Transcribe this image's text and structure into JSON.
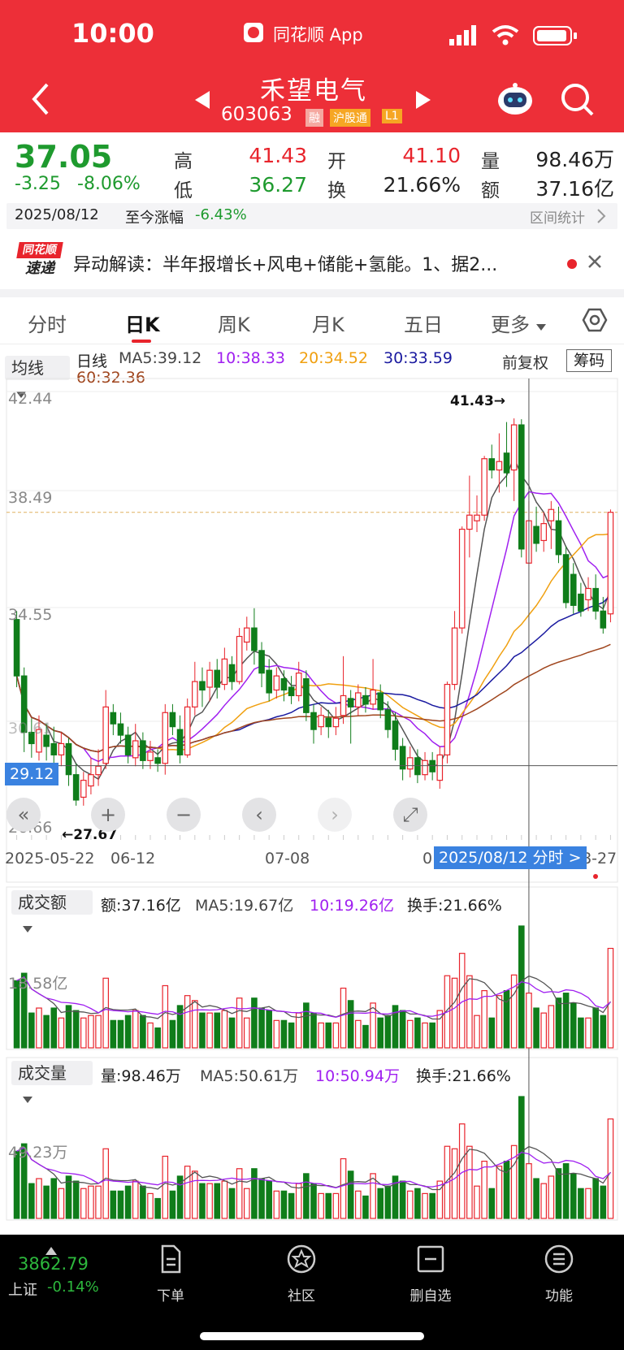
{
  "status_bar": {
    "time": "10:00",
    "app_name": "同花顺 App"
  },
  "header": {
    "stock_name": "禾望电气",
    "stock_code": "603063",
    "tags": [
      "融",
      "沪股通",
      "L1"
    ]
  },
  "quote": {
    "price": "37.05",
    "change": "-3.25",
    "change_pct": "-8.06%",
    "high_label": "高",
    "high": "41.43",
    "low_label": "低",
    "low": "36.27",
    "open_label": "开",
    "open": "41.10",
    "turnover_label": "换",
    "turnover": "21.66%",
    "volume_label": "量",
    "volume": "98.46万",
    "amount_label": "额",
    "amount": "37.16亿"
  },
  "date_bar": {
    "date": "2025/08/12",
    "since_label": "至今涨幅",
    "since_value": "-6.43%",
    "range_stats": "区间统计"
  },
  "news": {
    "logo_top": "同花顺",
    "logo_bottom": "速递",
    "text": "异动解读：半年报增长+风电+储能+氢能。1、据2..."
  },
  "tabs": [
    "分时",
    "日K",
    "周K",
    "月K",
    "五日",
    "更多"
  ],
  "ma_bar": {
    "dropdown": "均线",
    "period": "日线",
    "ma5": "MA5:39.12",
    "ma10": "10:38.33",
    "ma20": "20:34.52",
    "ma30": "30:33.59",
    "ma60": "60:32.36",
    "adjust": "前复权",
    "chips": "筹码"
  },
  "kline": {
    "y_labels": [
      "42.44",
      "38.49",
      "34.55",
      "30.61",
      "26.66"
    ],
    "current_price_tag": "29.12",
    "high_marker": "41.43→",
    "low_marker": "←27.67",
    "x_labels": [
      "2025-05-22",
      "06-12",
      "07-08",
      "0",
      "8-27"
    ],
    "crosshair_label": "2025/08/12 分时 >"
  },
  "amount_panel": {
    "dropdown": "成交额",
    "value": "额:37.16亿",
    "ma5": "MA5:19.67亿",
    "ma10": "10:19.26亿",
    "turnover": "换手:21.66%",
    "y_label": "18.58亿"
  },
  "volume_panel": {
    "dropdown": "成交量",
    "value": "量:98.46万",
    "ma5": "MA5:50.61万",
    "ma10": "10:50.94万",
    "turnover": "换手:21.66%",
    "y_label": "49.23万"
  },
  "bottom_nav": {
    "index_value": "3862.79",
    "index_name": "上证",
    "index_change": "-0.14%",
    "items": [
      "下单",
      "社区",
      "删自选",
      "功能"
    ]
  },
  "colors": {
    "up": "#e8242c",
    "down": "#0f7d1a",
    "ma5": "#555555",
    "ma10": "#a020f0",
    "ma20": "#f0a010",
    "ma30": "#1a1aa0",
    "ma60": "#a0461e",
    "header": "#ed2f38"
  },
  "chart_data": {
    "type": "candlestick",
    "ylim": [
      26.66,
      42.44
    ],
    "candles": [
      {
        "o": 34.3,
        "c": 32.3,
        "h": 34.6,
        "l": 31.9
      },
      {
        "o": 32.3,
        "c": 30.3,
        "h": 32.6,
        "l": 29.6
      },
      {
        "o": 30.3,
        "c": 29.9,
        "h": 30.8,
        "l": 29.4
      },
      {
        "o": 29.6,
        "c": 30.4,
        "h": 30.9,
        "l": 29.3
      },
      {
        "o": 30.2,
        "c": 29.8,
        "h": 30.6,
        "l": 29.3
      },
      {
        "o": 29.9,
        "c": 29.5,
        "h": 30.5,
        "l": 28.9
      },
      {
        "o": 29.5,
        "c": 29.9,
        "h": 30.3,
        "l": 29.1
      },
      {
        "o": 29.9,
        "c": 28.8,
        "h": 30.1,
        "l": 28.4
      },
      {
        "o": 28.8,
        "c": 27.9,
        "h": 29.2,
        "l": 27.7
      },
      {
        "o": 28.0,
        "c": 28.6,
        "h": 28.9,
        "l": 27.7
      },
      {
        "o": 28.4,
        "c": 28.8,
        "h": 29.4,
        "l": 28.1
      },
      {
        "o": 28.8,
        "c": 29.1,
        "h": 29.7,
        "l": 28.4
      },
      {
        "o": 29.2,
        "c": 31.2,
        "h": 31.8,
        "l": 29.0
      },
      {
        "o": 31.0,
        "c": 30.6,
        "h": 31.3,
        "l": 30.2
      },
      {
        "o": 30.6,
        "c": 30.2,
        "h": 31.0,
        "l": 29.9
      },
      {
        "o": 30.2,
        "c": 29.5,
        "h": 30.5,
        "l": 29.2
      },
      {
        "o": 29.4,
        "c": 30.0,
        "h": 30.6,
        "l": 29.1
      },
      {
        "o": 30.0,
        "c": 29.3,
        "h": 30.3,
        "l": 29.0
      },
      {
        "o": 29.3,
        "c": 29.6,
        "h": 30.0,
        "l": 29.0
      },
      {
        "o": 29.4,
        "c": 29.2,
        "h": 29.7,
        "l": 28.9
      },
      {
        "o": 29.2,
        "c": 31.0,
        "h": 31.3,
        "l": 28.8
      },
      {
        "o": 31.0,
        "c": 30.5,
        "h": 31.3,
        "l": 30.2
      },
      {
        "o": 30.4,
        "c": 29.5,
        "h": 30.9,
        "l": 29.2
      },
      {
        "o": 29.5,
        "c": 31.2,
        "h": 31.5,
        "l": 29.4
      },
      {
        "o": 31.2,
        "c": 32.1,
        "h": 32.8,
        "l": 30.9
      },
      {
        "o": 32.1,
        "c": 31.8,
        "h": 32.6,
        "l": 31.2
      },
      {
        "o": 31.9,
        "c": 32.5,
        "h": 32.8,
        "l": 31.4
      },
      {
        "o": 32.5,
        "c": 31.9,
        "h": 32.9,
        "l": 31.5
      },
      {
        "o": 32.0,
        "c": 32.9,
        "h": 33.3,
        "l": 31.8
      },
      {
        "o": 32.7,
        "c": 32.1,
        "h": 33.0,
        "l": 31.8
      },
      {
        "o": 32.1,
        "c": 33.7,
        "h": 34.0,
        "l": 32.0
      },
      {
        "o": 33.5,
        "c": 34.0,
        "h": 34.4,
        "l": 33.2
      },
      {
        "o": 34.0,
        "c": 33.2,
        "h": 34.7,
        "l": 32.7
      },
      {
        "o": 33.2,
        "c": 32.4,
        "h": 33.5,
        "l": 31.9
      },
      {
        "o": 32.5,
        "c": 31.7,
        "h": 32.9,
        "l": 31.4
      },
      {
        "o": 31.8,
        "c": 32.3,
        "h": 32.6,
        "l": 31.5
      },
      {
        "o": 32.2,
        "c": 31.8,
        "h": 32.5,
        "l": 31.4
      },
      {
        "o": 31.9,
        "c": 31.6,
        "h": 32.3,
        "l": 31.3
      },
      {
        "o": 31.6,
        "c": 32.4,
        "h": 32.8,
        "l": 31.4
      },
      {
        "o": 32.2,
        "c": 31.0,
        "h": 32.5,
        "l": 30.7
      },
      {
        "o": 31.0,
        "c": 30.4,
        "h": 31.3,
        "l": 29.9
      },
      {
        "o": 30.5,
        "c": 30.9,
        "h": 31.2,
        "l": 30.2
      },
      {
        "o": 30.8,
        "c": 30.5,
        "h": 31.1,
        "l": 30.1
      },
      {
        "o": 30.5,
        "c": 30.8,
        "h": 31.2,
        "l": 30.2
      },
      {
        "o": 30.9,
        "c": 31.6,
        "h": 33.0,
        "l": 30.6
      },
      {
        "o": 31.5,
        "c": 31.2,
        "h": 31.8,
        "l": 29.9
      },
      {
        "o": 31.2,
        "c": 31.7,
        "h": 32.0,
        "l": 30.9
      },
      {
        "o": 31.6,
        "c": 31.3,
        "h": 31.9,
        "l": 31.0
      },
      {
        "o": 31.3,
        "c": 31.8,
        "h": 32.9,
        "l": 31.1
      },
      {
        "o": 31.7,
        "c": 31.1,
        "h": 32.0,
        "l": 30.8
      },
      {
        "o": 31.1,
        "c": 30.4,
        "h": 31.4,
        "l": 30.1
      },
      {
        "o": 30.7,
        "c": 29.7,
        "h": 31.0,
        "l": 29.3
      },
      {
        "o": 29.8,
        "c": 29.0,
        "h": 30.1,
        "l": 28.6
      },
      {
        "o": 29.0,
        "c": 29.4,
        "h": 29.8,
        "l": 28.7
      },
      {
        "o": 29.4,
        "c": 28.8,
        "h": 29.7,
        "l": 28.5
      },
      {
        "o": 28.8,
        "c": 29.3,
        "h": 29.6,
        "l": 28.6
      },
      {
        "o": 29.3,
        "c": 28.9,
        "h": 29.6,
        "l": 28.6
      },
      {
        "o": 28.6,
        "c": 29.5,
        "h": 29.8,
        "l": 28.3
      },
      {
        "o": 29.5,
        "c": 32.0,
        "h": 32.1,
        "l": 29.2
      },
      {
        "o": 32.0,
        "c": 34.0,
        "h": 34.6,
        "l": 31.8
      },
      {
        "o": 34.0,
        "c": 37.5,
        "h": 37.6,
        "l": 33.8
      },
      {
        "o": 37.5,
        "c": 38.0,
        "h": 39.4,
        "l": 36.5
      },
      {
        "o": 37.8,
        "c": 38.0,
        "h": 38.7,
        "l": 37.4
      },
      {
        "o": 38.0,
        "c": 40.0,
        "h": 40.1,
        "l": 37.8
      },
      {
        "o": 40.0,
        "c": 39.6,
        "h": 40.5,
        "l": 39.3
      },
      {
        "o": 39.6,
        "c": 39.9,
        "h": 40.9,
        "l": 38.8
      },
      {
        "o": 40.2,
        "c": 39.5,
        "h": 41.3,
        "l": 39.0
      },
      {
        "o": 39.6,
        "c": 41.2,
        "h": 41.43,
        "l": 38.5
      },
      {
        "o": 41.2,
        "c": 36.8,
        "h": 41.4,
        "l": 36.5
      },
      {
        "o": 36.3,
        "c": 37.8,
        "h": 38.5,
        "l": 36.3
      },
      {
        "o": 37.6,
        "c": 37.0,
        "h": 38.3,
        "l": 36.7
      },
      {
        "o": 37.1,
        "c": 37.7,
        "h": 38.1,
        "l": 36.7
      },
      {
        "o": 37.8,
        "c": 38.2,
        "h": 38.5,
        "l": 36.8
      },
      {
        "o": 37.8,
        "c": 36.6,
        "h": 38.3,
        "l": 36.3
      },
      {
        "o": 36.6,
        "c": 34.9,
        "h": 36.9,
        "l": 34.7
      },
      {
        "o": 35.9,
        "c": 34.8,
        "h": 36.3,
        "l": 34.5
      },
      {
        "o": 35.2,
        "c": 34.6,
        "h": 35.6,
        "l": 34.4
      },
      {
        "o": 35.0,
        "c": 35.4,
        "h": 35.8,
        "l": 34.6
      },
      {
        "o": 35.4,
        "c": 34.6,
        "h": 35.9,
        "l": 34.3
      },
      {
        "o": 34.6,
        "c": 34.0,
        "h": 35.1,
        "l": 33.8
      },
      {
        "o": 34.5,
        "c": 38.1,
        "h": 38.2,
        "l": 34.2
      }
    ]
  }
}
